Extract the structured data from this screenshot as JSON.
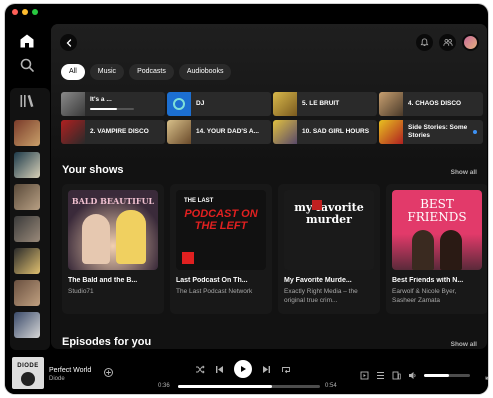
{
  "window": {
    "traffic_lights": [
      "#ff5f57",
      "#febc2e",
      "#28c840"
    ]
  },
  "nav": {
    "home_icon": "home-icon",
    "search_icon": "search-icon",
    "library_icon": "library-icon"
  },
  "filters": [
    {
      "label": "All",
      "active": true
    },
    {
      "label": "Music",
      "active": false
    },
    {
      "label": "Podcasts",
      "active": false
    },
    {
      "label": "Audiobooks",
      "active": false
    }
  ],
  "shortcuts": [
    {
      "label": "It's a ...",
      "progress": 0.62
    },
    {
      "label": "DJ"
    },
    {
      "label": "5. LE BRUIT"
    },
    {
      "label": "4. CHAOS DISCO"
    },
    {
      "label": "2. VAMPIRE DISCO"
    },
    {
      "label": "14. YOUR DAD'S A..."
    },
    {
      "label": "10. SAD GIRL HOURS"
    },
    {
      "label": "Side Stories: Some Stories",
      "new_dot": true
    }
  ],
  "your_shows": {
    "title": "Your shows",
    "show_all": "Show all",
    "items": [
      {
        "title": "The Bald and the B...",
        "subtitle": "Studio71",
        "cover_text": "BALD BEAUTIFUL"
      },
      {
        "title": "Last Podcast On Th...",
        "subtitle": "The Last Podcast Network",
        "cover_text": "PODCAST ON THE LEFT",
        "cover_small": "THE LAST"
      },
      {
        "title": "My Favorite Murde...",
        "subtitle": "Exactly Right Media – the original true crim...",
        "cover_text": "my favorite murder"
      },
      {
        "title": "Best Friends with N...",
        "subtitle": "Earwolf & Nicole Byer, Sasheer Zamata",
        "cover_text": "BEST FRIENDS"
      }
    ]
  },
  "episodes": {
    "title": "Episodes for you",
    "show_all": "Show all"
  },
  "player": {
    "title": "Perfect World",
    "artist": "Diode",
    "cover_text": "DIODE",
    "elapsed": "0:36",
    "duration": "0:54",
    "progress": 0.66,
    "volume": 0.55
  },
  "colors": {
    "accent": "#1ed760",
    "background": "#121212"
  }
}
